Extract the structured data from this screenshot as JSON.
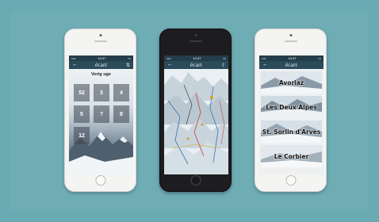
{
  "app": {
    "logo": "écart"
  },
  "status_bar": {
    "time": "10:37",
    "carrier": "•••• ",
    "battery": ""
  },
  "icons": {
    "back": "arrow-left-icon",
    "filter": "sort-icon",
    "share": "share-icon"
  },
  "stats_screen": {
    "title": "Vorig uge",
    "tiles": [
      "52",
      "3",
      "4",
      "5",
      "?",
      "8",
      "12",
      "",
      ""
    ]
  },
  "resorts_screen": {
    "resorts": [
      "Avoriaz",
      "Les Deux Alpes",
      "St. Sorlin d'Arves",
      "Le Corbier"
    ]
  },
  "colors": {
    "background": "#6aaab2",
    "appbar": "#2b4b5a",
    "statusbar": "#243d4a"
  }
}
